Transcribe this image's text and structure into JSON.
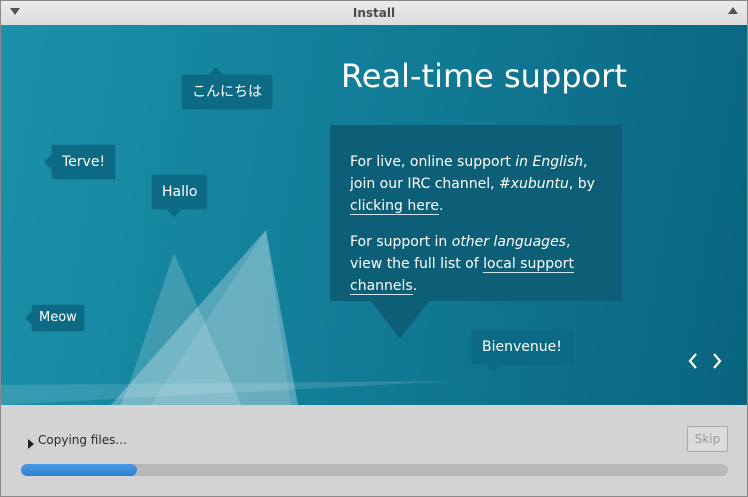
{
  "window": {
    "title": "Install"
  },
  "slide": {
    "title": "Real-time support",
    "bubbles": {
      "konnichiwa": "こんにちは",
      "terve": "Terve!",
      "hallo": "Hallo",
      "meow": "Meow",
      "bienvenue": "Bienvenue!"
    },
    "info": {
      "p1_a": "For live, online support ",
      "p1_em1": "in English",
      "p1_b": ", join our IRC channel, ",
      "p1_em2": "#xubuntu",
      "p1_c": ", by ",
      "p1_link": "clicking here",
      "p1_d": ".",
      "p2_a": "For support in ",
      "p2_em": "other languages",
      "p2_b": ", view the full list of ",
      "p2_link": "local support channels",
      "p2_c": "."
    },
    "nav": {
      "prev": "‹",
      "next": "›"
    }
  },
  "footer": {
    "status": "Copying files...",
    "skip_label": "Skip",
    "progress_percent": 16.4
  },
  "colors": {
    "accent": "#2f7fd1",
    "slide_bg": "#127e99",
    "bubble_bg": "#0c6a84"
  }
}
